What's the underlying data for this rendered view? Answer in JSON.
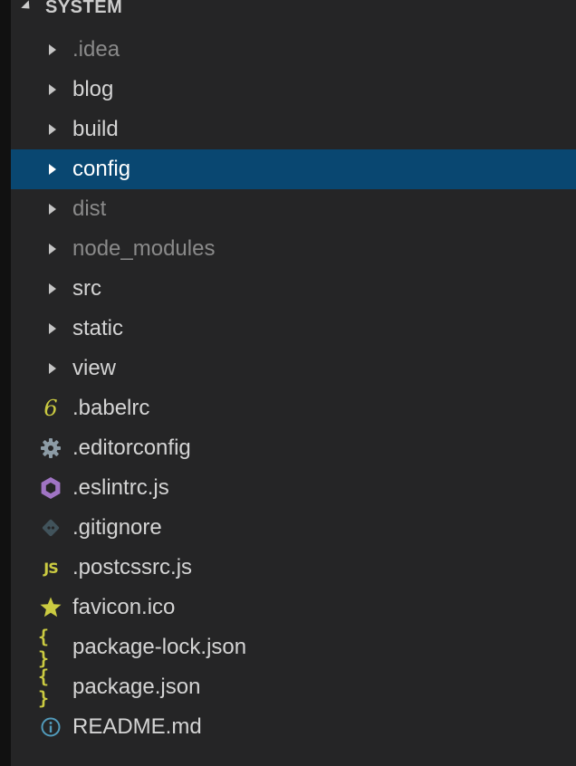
{
  "explorer": {
    "section_title": "SYSTEM",
    "items": [
      {
        "label": ".idea",
        "kind": "folder",
        "dim": true,
        "icon": "chevron-right-icon"
      },
      {
        "label": "blog",
        "kind": "folder",
        "dim": false,
        "icon": "chevron-right-icon"
      },
      {
        "label": "build",
        "kind": "folder",
        "dim": false,
        "icon": "chevron-right-icon"
      },
      {
        "label": "config",
        "kind": "folder",
        "dim": false,
        "selected": true,
        "icon": "chevron-right-icon"
      },
      {
        "label": "dist",
        "kind": "folder",
        "dim": true,
        "icon": "chevron-right-icon"
      },
      {
        "label": "node_modules",
        "kind": "folder",
        "dim": true,
        "icon": "chevron-right-icon"
      },
      {
        "label": "src",
        "kind": "folder",
        "dim": false,
        "icon": "chevron-right-icon"
      },
      {
        "label": "static",
        "kind": "folder",
        "dim": false,
        "icon": "chevron-right-icon"
      },
      {
        "label": "view",
        "kind": "folder",
        "dim": false,
        "icon": "chevron-right-icon"
      },
      {
        "label": ".babelrc",
        "kind": "file",
        "icon": "babel-icon",
        "glyph": "6"
      },
      {
        "label": ".editorconfig",
        "kind": "file",
        "icon": "gear-icon"
      },
      {
        "label": ".eslintrc.js",
        "kind": "file",
        "icon": "eslint-icon"
      },
      {
        "label": ".gitignore",
        "kind": "file",
        "icon": "git-icon"
      },
      {
        "label": ".postcssrc.js",
        "kind": "file",
        "icon": "javascript-icon",
        "glyph": "JS"
      },
      {
        "label": "favicon.ico",
        "kind": "file",
        "icon": "star-icon"
      },
      {
        "label": "package-lock.json",
        "kind": "file",
        "icon": "json-icon",
        "glyph": "{ }"
      },
      {
        "label": "package.json",
        "kind": "file",
        "icon": "json-icon",
        "glyph": "{ }"
      },
      {
        "label": "README.md",
        "kind": "file",
        "icon": "info-icon"
      }
    ]
  },
  "colors": {
    "panel_background": "#252526",
    "selection": "#094771",
    "text": "#d4d4d4",
    "dim_text": "#8a8a8a",
    "yellow_icon": "#cbcb41",
    "gear": "#8c9ba5",
    "eslint": "#a074c4",
    "git": "#41535b",
    "info": "#519aba"
  }
}
